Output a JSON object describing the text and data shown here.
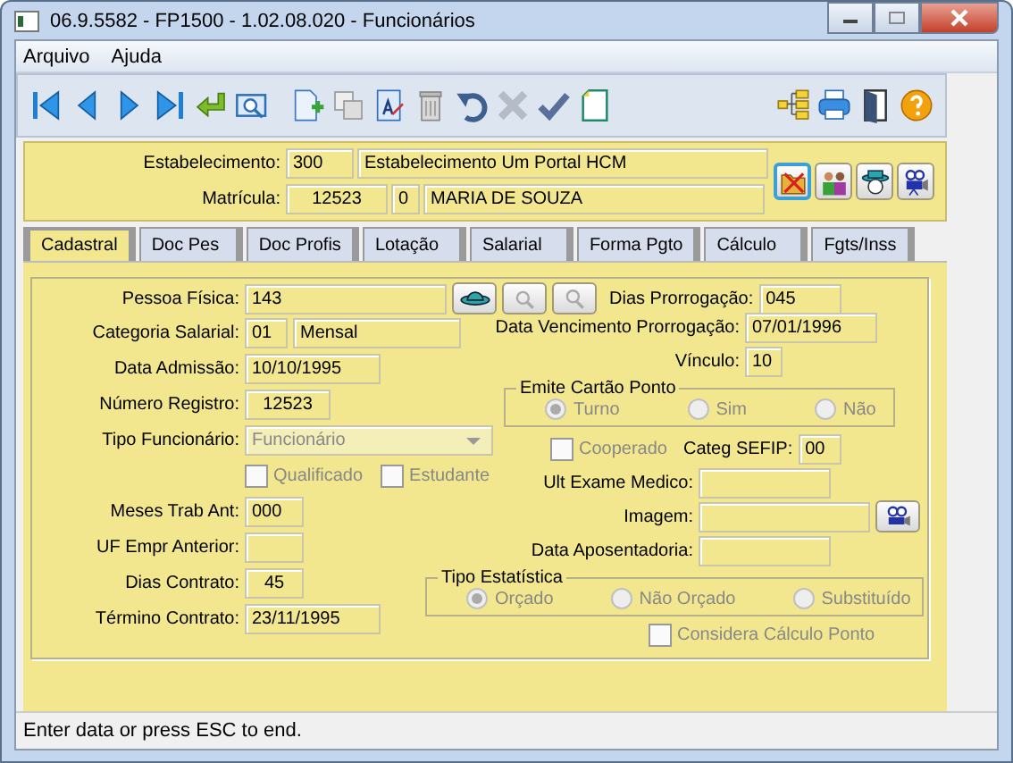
{
  "window": {
    "title": "06.9.5582 - FP1500 - 1.02.08.020 - Funcionários"
  },
  "menu": [
    "Arquivo",
    "Ajuda"
  ],
  "header": {
    "estab_label": "Estabelecimento:",
    "estab_code": "300",
    "estab_name": "Estabelecimento Um Portal HCM",
    "matr_label": "Matrícula:",
    "matr_number": "12523",
    "matr_digit": "0",
    "matr_name": "MARIA DE SOUZA"
  },
  "tabs": [
    {
      "label": "Cadastral",
      "selected": true
    },
    {
      "label": "Doc Pes",
      "selected": false
    },
    {
      "label": "Doc Profis",
      "selected": false
    },
    {
      "label": "Lotação",
      "selected": false
    },
    {
      "label": "Salarial",
      "selected": false
    },
    {
      "label": "Forma Pgto",
      "selected": false
    },
    {
      "label": "Cálculo",
      "selected": false
    },
    {
      "label": "Fgts/Inss",
      "selected": false
    }
  ],
  "form": {
    "pessoa_fisica": {
      "label": "Pessoa Física:",
      "value": "143"
    },
    "dias_prorrogacao": {
      "label": "Dias Prorrogação:",
      "value": "045"
    },
    "categoria": {
      "label": "Categoria Salarial:",
      "code": "01",
      "value": "Mensal"
    },
    "data_admissao": {
      "label": "Data Admissão:",
      "value": "10/10/1995"
    },
    "numero_registro": {
      "label": "Número Registro:",
      "value": "12523"
    },
    "tipo_funcionario": {
      "label": "Tipo Funcionário:",
      "value": "Funcionário",
      "disabled": true
    },
    "checks_left": [
      {
        "label": "Qualificado",
        "checked": false,
        "disabled": true
      },
      {
        "label": "Estudante",
        "checked": false,
        "disabled": true
      }
    ],
    "meses_trab": {
      "label": "Meses Trab Ant:",
      "value": "000"
    },
    "uf_empr": {
      "label": "UF Empr Anterior:"
    },
    "dias_contrato": {
      "label": "Dias Contrato:",
      "value": "45"
    },
    "termino_contrato": {
      "label": "Término Contrato:",
      "value": "23/11/1995"
    },
    "data_venc": {
      "label": "Data Vencimento Prorrogação:",
      "value": "07/01/1996"
    },
    "vinculo": {
      "label": "Vínculo:",
      "value": "10"
    },
    "emite_cartao": {
      "title": "Emite Cartão Ponto",
      "disabled": true,
      "options": [
        {
          "label": "Turno",
          "selected": true
        },
        {
          "label": "Sim",
          "selected": false
        },
        {
          "label": "Não",
          "selected": false
        }
      ]
    },
    "cooperado": {
      "label": "Cooperado",
      "checked": false,
      "disabled": true
    },
    "categ_sefip": {
      "label": "Categ SEFIP:",
      "value": "00"
    },
    "ult_exame": {
      "label": "Ult Exame Medico:"
    },
    "imagem": {
      "label": "Imagem:"
    },
    "data_aposentadoria": {
      "label": "Data Aposentadoria:"
    },
    "tipo_estatistica": {
      "title": "Tipo Estatística",
      "disabled": true,
      "options": [
        {
          "label": "Orçado",
          "selected": true
        },
        {
          "label": "Não Orçado",
          "selected": false
        },
        {
          "label": "Substituído",
          "selected": false
        }
      ]
    },
    "considera": {
      "label": "Considera Cálculo Ponto",
      "checked": false,
      "disabled": true
    }
  },
  "status_bar": "Enter data or press ESC to end."
}
